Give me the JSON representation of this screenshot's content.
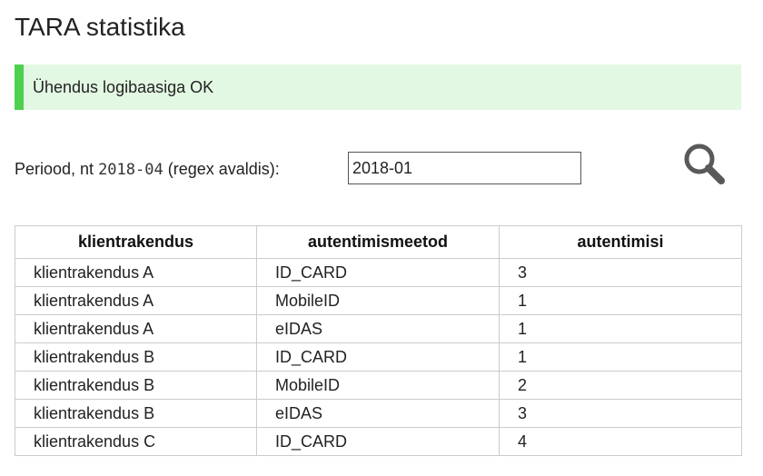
{
  "page": {
    "title": "TARA statistika"
  },
  "status": {
    "message": "Ühendus logibaasiga OK",
    "color": "#4ed14e",
    "background": "#e3f8e3"
  },
  "filter": {
    "label_prefix": "Periood, nt ",
    "label_example": "2018-04",
    "label_suffix": " (regex avaldis):",
    "value": "2018-01",
    "search_icon": "search-icon"
  },
  "table": {
    "headers": [
      "klientrakendus",
      "autentimismeetod",
      "autentimisi"
    ],
    "rows": [
      [
        "klientrakendus A",
        "ID_CARD",
        "3"
      ],
      [
        "klientrakendus A",
        "MobileID",
        "1"
      ],
      [
        "klientrakendus A",
        "eIDAS",
        "1"
      ],
      [
        "klientrakendus B",
        "ID_CARD",
        "1"
      ],
      [
        "klientrakendus B",
        "MobileID",
        "2"
      ],
      [
        "klientrakendus B",
        "eIDAS",
        "3"
      ],
      [
        "klientrakendus C",
        "ID_CARD",
        "4"
      ]
    ]
  }
}
